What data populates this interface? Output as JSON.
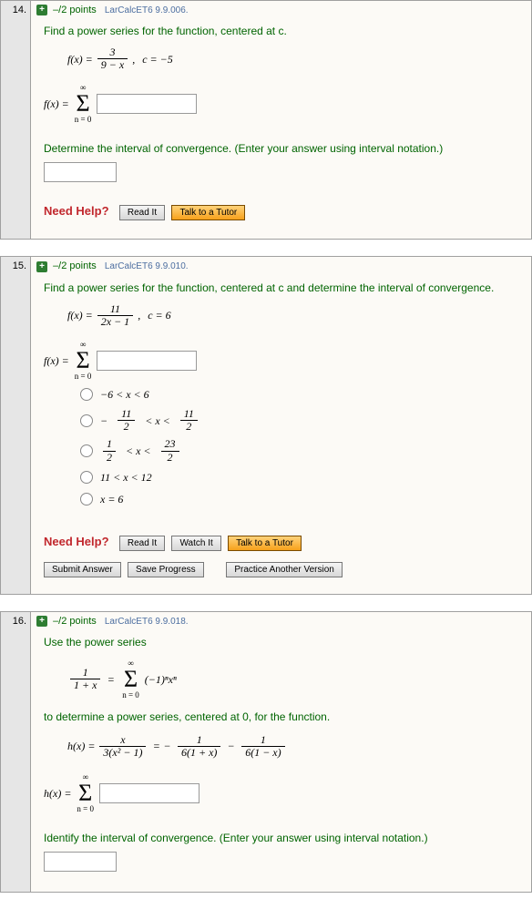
{
  "questions": [
    {
      "number": "14.",
      "points": "–/2 points",
      "source": "LarCalcET6 9.9.006.",
      "prompt": "Find a power series for the function, centered at c.",
      "func_lhs": "f(x) =",
      "frac1_num": "3",
      "frac1_den": "9 − x",
      "center": "c = −5",
      "series_lhs": "f(x) = ",
      "sigma_top": "∞",
      "sigma_bot": "n = 0",
      "conv_prompt": "Determine the interval of convergence. (Enter your answer using interval notation.)",
      "help": "Need Help?",
      "btn_read": "Read It",
      "btn_tutor": "Talk to a Tutor"
    },
    {
      "number": "15.",
      "points": "–/2 points",
      "source": "LarCalcET6 9.9.010.",
      "prompt": "Find a power series for the function, centered at c and determine the interval of convergence.",
      "func_lhs": "f(x) =",
      "frac1_num": "11",
      "frac1_den": "2x − 1",
      "center": "c = 6",
      "series_lhs": "f(x) = ",
      "sigma_top": "∞",
      "sigma_bot": "n = 0",
      "opts": {
        "a": "−6 < x < 6",
        "b_lhs": "− ",
        "b_num1": "11",
        "b_den1": "2",
        "b_mid": " < x < ",
        "b_num2": "11",
        "b_den2": "2",
        "c_num1": "1",
        "c_den1": "2",
        "c_mid": " < x < ",
        "c_num2": "23",
        "c_den2": "2",
        "d": "11 < x < 12",
        "e": "x = 6"
      },
      "help": "Need Help?",
      "btn_read": "Read It",
      "btn_watch": "Watch It",
      "btn_tutor": "Talk to a Tutor",
      "btn_submit": "Submit Answer",
      "btn_save": "Save Progress",
      "btn_practice": "Practice Another Version"
    },
    {
      "number": "16.",
      "points": "–/2 points",
      "source": "LarCalcET6 9.9.018.",
      "prompt": "Use the power series",
      "g_num": "1",
      "g_den": "1 + x",
      "eq": "=",
      "sigma_top": "∞",
      "sigma_bot": "n = 0",
      "g_term": "(−1)ⁿxⁿ",
      "prompt2": "to determine a power series, centered at 0, for the function.",
      "h_lhs": "h(x) =",
      "h1_num": "x",
      "h1_den": "3(x² − 1)",
      "h2_num": "1",
      "h2_den": "6(1 + x)",
      "minus": "−",
      "h3_num": "1",
      "h3_den": "6(1 − x)",
      "series_lhs": "h(x) = ",
      "conv_prompt": "Identify the interval of convergence. (Enter your answer using interval notation.)"
    }
  ]
}
